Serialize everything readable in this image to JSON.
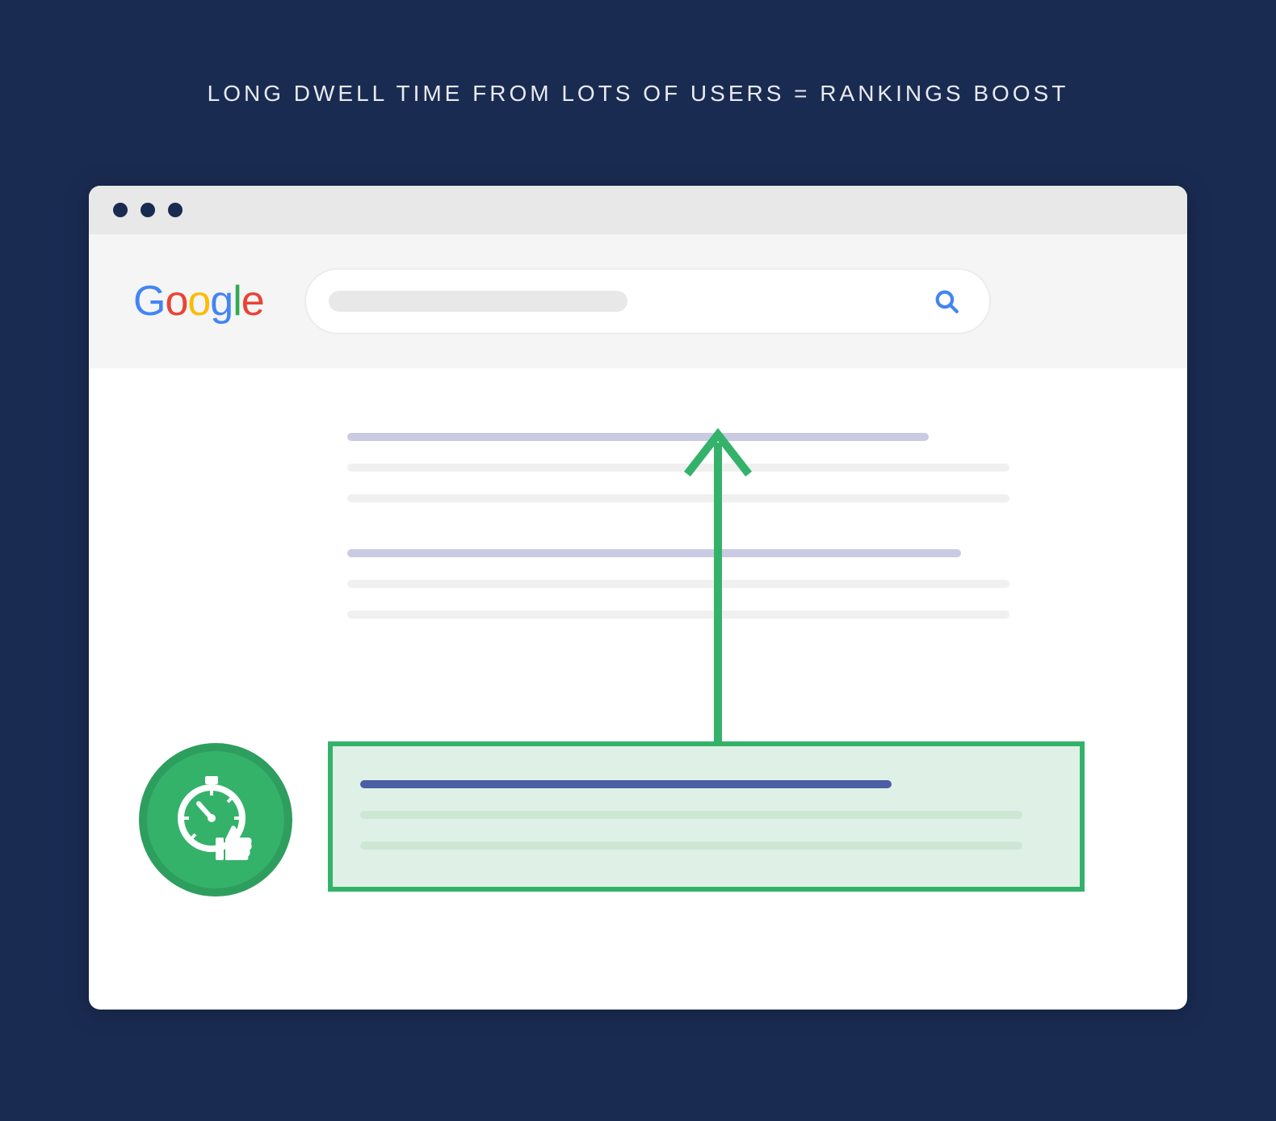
{
  "headline": "LONG DWELL TIME FROM LOTS OF USERS = RANKINGS BOOST",
  "brand": {
    "logo_letters": [
      "G",
      "o",
      "o",
      "g",
      "l",
      "e"
    ]
  },
  "search": {
    "placeholder": "",
    "value": ""
  },
  "icons": {
    "search": "search-icon",
    "badge": "stopwatch-thumbs-up-icon",
    "arrow": "upward-arrow-icon"
  },
  "colors": {
    "background": "#1a2b52",
    "accent_green": "#34b26a",
    "accent_green_dark": "#2e9e5e",
    "result_title": "#c9cbe2",
    "result_body": "#f0f0f0",
    "highlight_title": "#4a5fa5",
    "highlight_body": "#cce7d4",
    "google_blue": "#4285F4"
  },
  "results": [
    {
      "type": "normal",
      "title_width": 720,
      "body_widths": [
        820,
        820
      ]
    },
    {
      "type": "normal",
      "title_width": 760,
      "body_widths": [
        820,
        820
      ]
    },
    {
      "type": "highlighted",
      "title_width": 658,
      "body_widths": [
        820,
        820
      ]
    }
  ]
}
